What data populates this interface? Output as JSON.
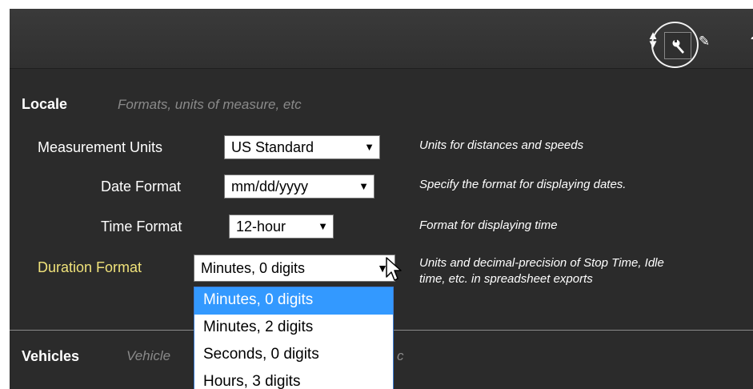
{
  "toolbar": {
    "icons": [
      "sort-icon",
      "wrench-icon",
      "pencil-icon",
      "help-icon"
    ],
    "help_glyph": "?"
  },
  "locale": {
    "title": "Locale",
    "description": "Formats, units of measure, etc",
    "rows": [
      {
        "label": "Measurement Units",
        "value": "US Standard",
        "help": "Units for distances and speeds"
      },
      {
        "label": "Date Format",
        "value": "mm/dd/yyyy",
        "help": "Specify the format for displaying dates."
      },
      {
        "label": "Time Format",
        "value": "12-hour",
        "help": "Format for displaying time"
      },
      {
        "label": "Duration Format",
        "value": "Minutes, 0 digits",
        "help": "Units and decimal-precision of Stop Time, Idle time, etc. in spreadsheet exports"
      }
    ],
    "duration_options": [
      "Minutes, 0 digits",
      "Minutes, 2 digits",
      "Seconds, 0 digits",
      "Hours, 3 digits"
    ],
    "duration_selected_index": 0
  },
  "vehicles": {
    "title": "Vehicles",
    "description_visible_start": "Vehicle",
    "description_visible_end": "c"
  },
  "colors": {
    "panel_bg": "#2b2b2b",
    "highlight_label": "#f0e27a",
    "selected_option_bg": "#3399ff",
    "muted_text": "#8a8a8a"
  }
}
